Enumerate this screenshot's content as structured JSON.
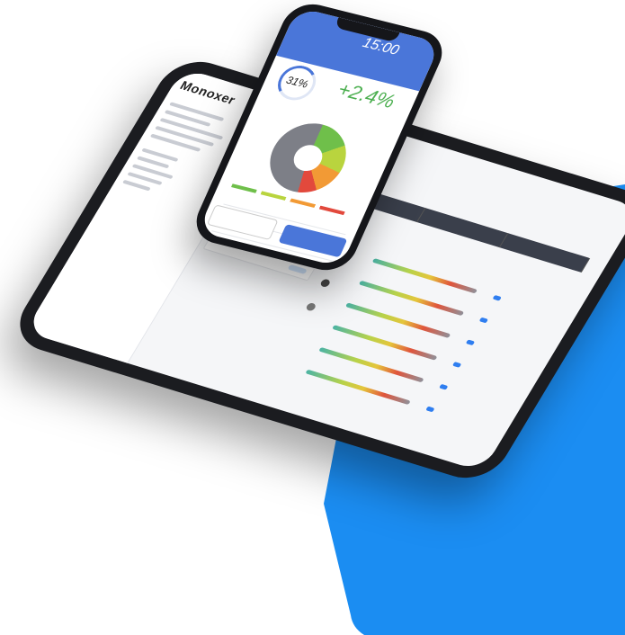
{
  "scene": {
    "description_labels": [],
    "colors": {
      "background_shape": "#1b8df2",
      "tablet_frame": "#1b1c20",
      "phone_frame": "#15161a",
      "phone_header": "#4a76d9",
      "positive_accent": "#4caf50"
    }
  },
  "tablet": {
    "app_name": "Monoxer"
  },
  "phone": {
    "time": "15:00",
    "progress_percent": "31%",
    "change": "+2.4%",
    "donut_slices": [
      {
        "name": "green",
        "color": "#6fbf4a",
        "fraction": 0.15
      },
      {
        "name": "yellow-green",
        "color": "#b9d43e",
        "fraction": 0.13
      },
      {
        "name": "orange",
        "color": "#f29a35",
        "fraction": 0.12
      },
      {
        "name": "red",
        "color": "#e2493c",
        "fraction": 0.08
      },
      {
        "name": "gray",
        "color": "#7d7f87",
        "fraction": 0.52
      }
    ]
  }
}
